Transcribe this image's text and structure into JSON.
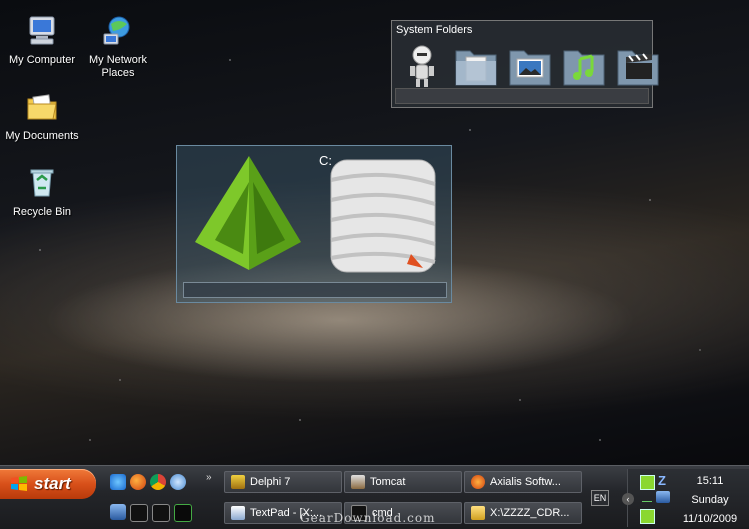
{
  "desktop": {
    "icons": [
      {
        "label": "My Computer",
        "icon": "computer-icon"
      },
      {
        "label": "My Network Places",
        "icon": "network-icon"
      },
      {
        "label": "My Documents",
        "icon": "documents-folder-icon"
      },
      {
        "label": "Recycle Bin",
        "icon": "recycle-bin-icon"
      }
    ]
  },
  "system_folders": {
    "title": "System Folders",
    "items": [
      "robot-figure-icon",
      "documents-folder-icon",
      "pictures-folder-icon",
      "music-folder-icon",
      "video-folder-icon"
    ]
  },
  "drive_widget": {
    "label": "C:",
    "icons": [
      "green-pyramid-icon",
      "wrapped-drive-icon"
    ]
  },
  "taskbar": {
    "start_label": "start",
    "quick_launch_top": [
      "ie-icon",
      "firefox-icon",
      "chrome-icon",
      "globe-icon"
    ],
    "quick_launch_bottom": [
      "app-icon",
      "cmd-icon",
      "cmd-icon",
      "terminal-icon"
    ],
    "buttons_top": [
      "Delphi 7",
      "Tomcat",
      "Axialis Softw..."
    ],
    "buttons_bottom": [
      "TextPad - [X:...",
      "cmd",
      "X:\\ZZZZ_CDR..."
    ],
    "language": "EN",
    "clock": {
      "time": "15:11",
      "day": "Sunday",
      "date": "11/10/2009"
    }
  },
  "watermark": "GearDownload.com",
  "colors": {
    "start_button": "#d8501a",
    "tray_green": "#8ad830"
  }
}
